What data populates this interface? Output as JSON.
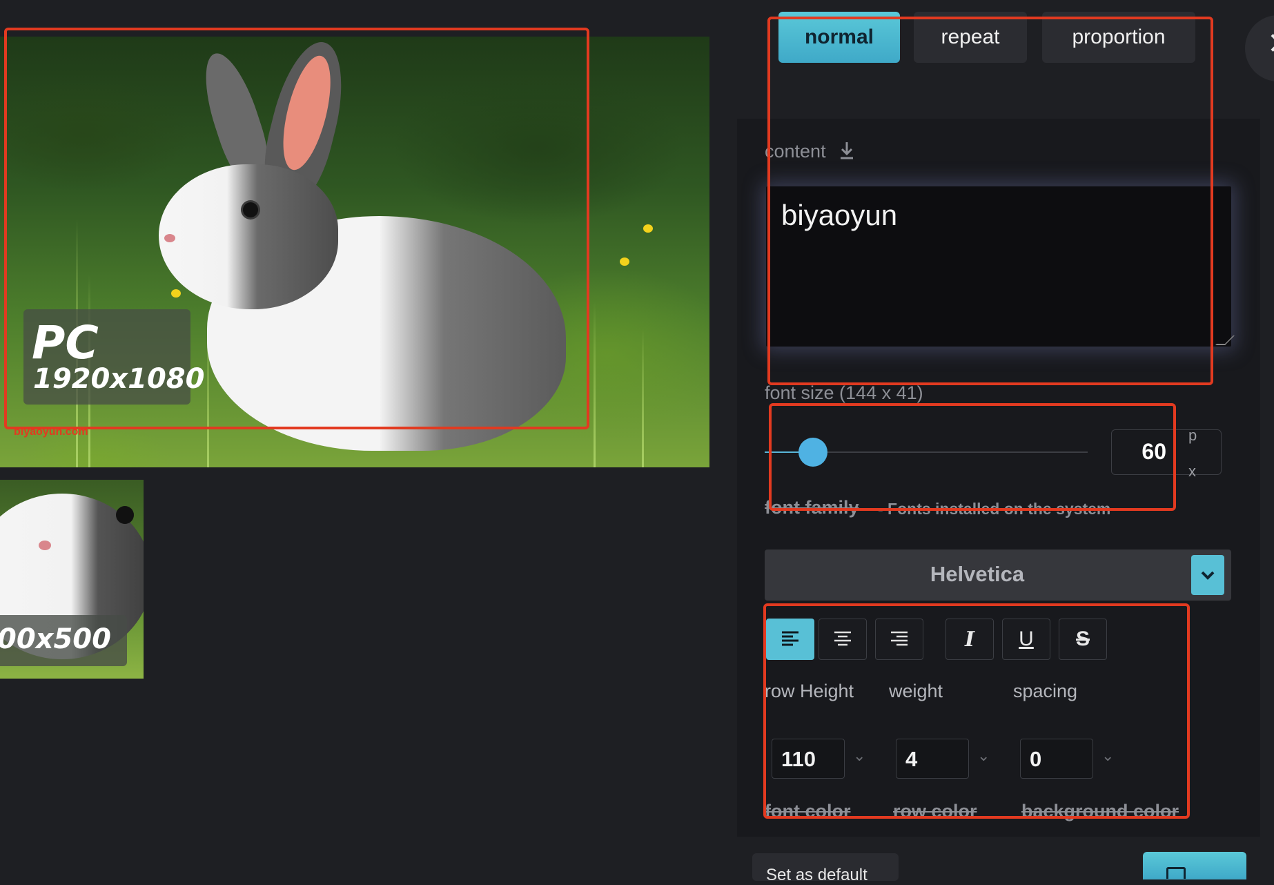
{
  "preview": {
    "main": {
      "badge_title": "PC",
      "badge_size": "1920x1080",
      "watermark": "biyaoyun.com"
    },
    "thumb": {
      "badge_size": "00x500"
    }
  },
  "tabs": [
    {
      "label": "normal",
      "active": true
    },
    {
      "label": "repeat",
      "active": false
    },
    {
      "label": "proportion",
      "active": false
    }
  ],
  "content": {
    "label": "content",
    "value": "biyaoyun"
  },
  "font_size": {
    "label": "font size (144 x 41)",
    "value": "60",
    "unit_p": "p",
    "unit_x": "x",
    "slider_fraction": 0.15
  },
  "font_family": {
    "label": "font family",
    "hint": "- Fonts installed on the system",
    "selected": "Helvetica"
  },
  "format": {
    "buttons": [
      {
        "name": "align-left",
        "active": true
      },
      {
        "name": "align-center",
        "active": false
      },
      {
        "name": "align-right",
        "active": false
      },
      {
        "name": "italic",
        "glyph": "I",
        "active": false
      },
      {
        "name": "underline",
        "glyph": "U",
        "active": false
      },
      {
        "name": "strikethrough",
        "glyph": "S",
        "active": false
      }
    ]
  },
  "params": {
    "row_height": {
      "label": "row Height",
      "value": "110"
    },
    "weight": {
      "label": "weight",
      "value": "4"
    },
    "spacing": {
      "label": "spacing",
      "value": "0"
    }
  },
  "colors_row": {
    "font_color": "font color",
    "row_color": "row color",
    "background_color": "background color"
  },
  "footer": {
    "set_default": "Set as default"
  },
  "theme": {
    "accent": "#58c0d6",
    "annotation": "#e23a20",
    "panel_bg": "#18191d"
  }
}
